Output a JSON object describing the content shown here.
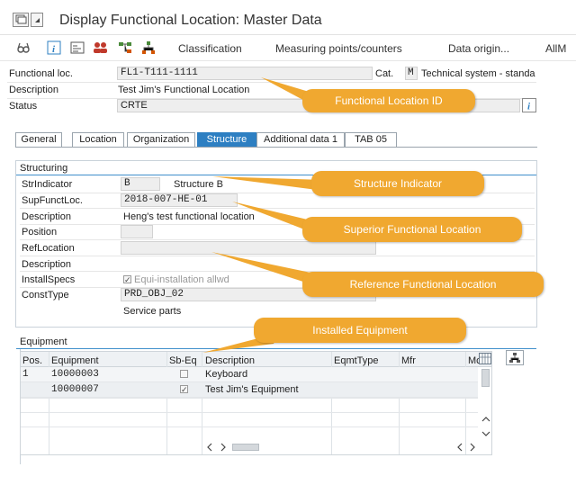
{
  "window": {
    "title": "Display Functional Location: Master Data"
  },
  "toolbar": {
    "classification": "Classification",
    "measuring": "Measuring points/counters",
    "data_origin": "Data origin...",
    "more": "AllM"
  },
  "header": {
    "funcloc_label": "Functional loc.",
    "funcloc_value": "FL1-T111-1111",
    "cat_label": "Cat.",
    "cat_value": "M",
    "cat_text": "Technical system - standa",
    "desc_label": "Description",
    "desc_value": "Test Jim's Functional Location",
    "status_label": "Status",
    "status_value": "CRTE"
  },
  "tabs": [
    "General",
    "Location",
    "Organization",
    "Structure",
    "Additional data 1",
    "TAB 05"
  ],
  "structuring": {
    "title": "Structuring",
    "str_indicator_label": "StrIndicator",
    "str_indicator_value": "B",
    "str_indicator_text": "Structure B",
    "sup_label": "SupFunctLoc.",
    "sup_value": "2018-007-HE-01",
    "sup_desc_label": "Description",
    "sup_desc_value": "Heng's test functional location",
    "position_label": "Position",
    "refloc_label": "RefLocation",
    "ref_desc_label": "Description",
    "install_label": "InstallSpecs",
    "install_checkbox": "Equi-installation allwd",
    "const_label": "ConstType",
    "const_value": "PRD_OBJ_02",
    "service_parts": "Service parts"
  },
  "equipment": {
    "title": "Equipment",
    "columns": [
      "Pos.",
      "Equipment",
      "Sb-Eq",
      "Description",
      "EqmtType",
      "Mfr",
      "Mc"
    ],
    "rows": [
      {
        "pos": "1",
        "equipment": "10000003",
        "sbeq": false,
        "description": "Keyboard"
      },
      {
        "pos": "",
        "equipment": "10000007",
        "sbeq": true,
        "description": "Test Jim's Equipment"
      }
    ]
  },
  "callouts": {
    "funcloc_id": "Functional Location ID",
    "structure_indicator": "Structure Indicator",
    "superior": "Superior Functional Location",
    "reference": "Reference Functional Location",
    "installed": "Installed Equipment"
  },
  "colors": {
    "accent": "#2d7fc2",
    "callout": "#f0a830"
  },
  "icons": [
    "screen-icon",
    "dropdown-icon",
    "glasses-icon",
    "info-icon",
    "list-icon",
    "users-icon",
    "hierarchy-icon",
    "org-icon",
    "grid-icon"
  ]
}
